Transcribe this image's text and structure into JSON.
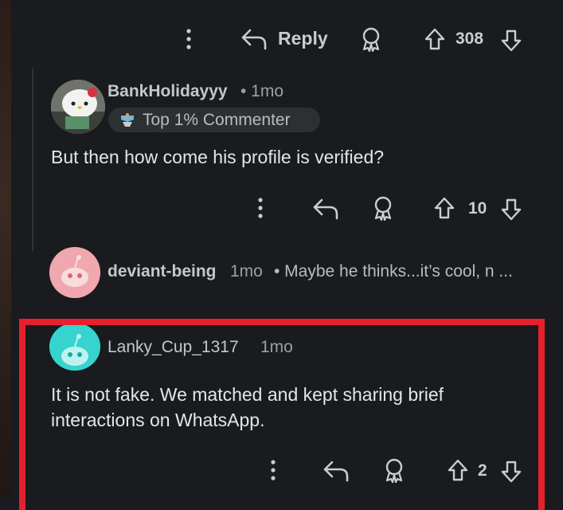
{
  "colors": {
    "background": "#1a1b1f",
    "highlight": "#e8202e",
    "text": "#e3e6e8",
    "meta": "#9aa0a6"
  },
  "top_actions": {
    "reply_label": "Reply",
    "vote_count": "308"
  },
  "comment_1": {
    "username": "BankHolidayyy",
    "time": "• 1mo",
    "badge_label": "Top 1% Commenter",
    "text": "But then how come his profile is verified?",
    "vote_count": "10"
  },
  "comment_2": {
    "username": "deviant-being",
    "time": "1mo",
    "preview": "• Maybe he thinks...it’s cool, n ..."
  },
  "comment_3": {
    "username": "Lanky_Cup_1317",
    "time": "1mo",
    "text_line1": "It is not fake. We matched and kept sharing brief",
    "text_line2": "interactions on WhatsApp.",
    "vote_count": "2"
  }
}
